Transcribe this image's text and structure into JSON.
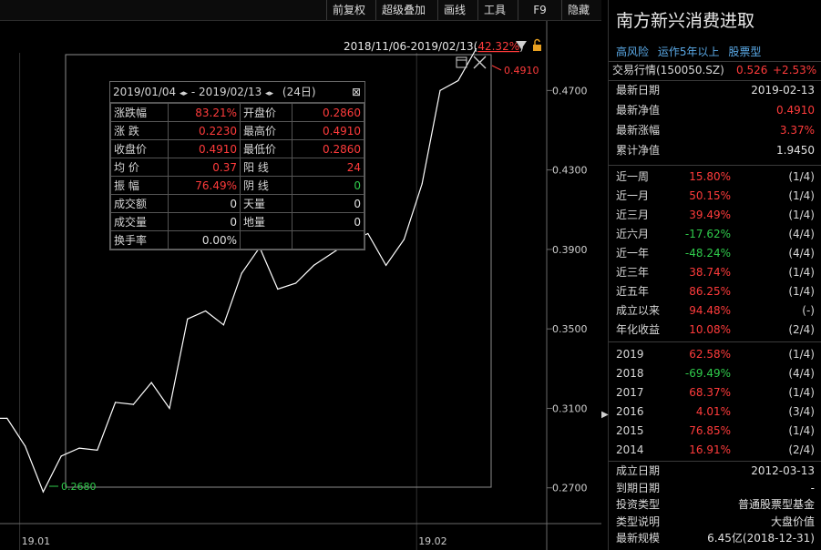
{
  "toolbar": {
    "items": [
      "前复权",
      "超级叠加",
      "画线",
      "工具",
      "F9",
      "隐藏"
    ]
  },
  "chart": {
    "range_label": "2018/11/06-2019/02/13(",
    "range_pct": "42.32%",
    "range_close": ")",
    "high_label": "0.4910",
    "low_label": "0.2680",
    "y_ticks": [
      "0.4700",
      "0.4300",
      "0.3900",
      "0.3500",
      "0.3100",
      "0.2700"
    ],
    "x_ticks": [
      "19.01",
      "19.02"
    ]
  },
  "chart_data": {
    "type": "line",
    "x": [
      "2018-12-27",
      "2018-12-28",
      "2019-01-02",
      "2019-01-03",
      "2019-01-04",
      "2019-01-07",
      "2019-01-08",
      "2019-01-09",
      "2019-01-10",
      "2019-01-11",
      "2019-01-14",
      "2019-01-15",
      "2019-01-16",
      "2019-01-17",
      "2019-01-18",
      "2019-01-21",
      "2019-01-22",
      "2019-01-23",
      "2019-01-24",
      "2019-01-25",
      "2019-01-28",
      "2019-01-29",
      "2019-01-30",
      "2019-01-31",
      "2019-02-01",
      "2019-02-11",
      "2019-02-12",
      "2019-02-13"
    ],
    "values": [
      0.305,
      0.305,
      0.291,
      0.268,
      0.286,
      0.29,
      0.289,
      0.313,
      0.312,
      0.323,
      0.31,
      0.355,
      0.359,
      0.352,
      0.378,
      0.391,
      0.37,
      0.373,
      0.382,
      0.388,
      0.394,
      0.398,
      0.382,
      0.395,
      0.423,
      0.47,
      0.475,
      0.491
    ],
    "ylim": [
      0.252,
      0.505
    ],
    "title": "",
    "xlabel": "",
    "ylabel": ""
  },
  "popup": {
    "date_from": "2019/01/04",
    "date_to": "2019/02/13",
    "days": "(24日)",
    "rows": [
      {
        "l1": "涨跌幅",
        "v1": "83.21%",
        "c1": "red",
        "l2": "开盘价",
        "v2": "0.2860",
        "c2": "red"
      },
      {
        "l1": "涨 跌",
        "v1": "0.2230",
        "c1": "red",
        "l2": "最高价",
        "v2": "0.4910",
        "c2": "red"
      },
      {
        "l1": "收盘价",
        "v1": "0.4910",
        "c1": "red",
        "l2": "最低价",
        "v2": "0.2860",
        "c2": "red"
      },
      {
        "l1": "均 价",
        "v1": "0.37",
        "c1": "red",
        "l2": "阳 线",
        "v2": "24",
        "c2": "red"
      },
      {
        "l1": "振 幅",
        "v1": "76.49%",
        "c1": "red",
        "l2": "阴 线",
        "v2": "0",
        "c2": "green"
      },
      {
        "l1": "成交额",
        "v1": "0",
        "c1": "white",
        "l2": "天量",
        "v2": "0",
        "c2": "white"
      },
      {
        "l1": "成交量",
        "v1": "0",
        "c1": "white",
        "l2": "地量",
        "v2": "0",
        "c2": "white"
      },
      {
        "l1": "换手率",
        "v1": "0.00%",
        "c1": "white",
        "l2": "",
        "v2": "",
        "c2": "white"
      }
    ]
  },
  "panel": {
    "title": "南方新兴消费进取",
    "tags": [
      "高风险",
      "运作5年以上",
      "股票型"
    ],
    "quote_label": "交易行情(150050.SZ)",
    "quote_price": "0.526",
    "quote_change": "+2.53%",
    "info": [
      {
        "k": "最新日期",
        "v": "2019-02-13",
        "c": "white"
      },
      {
        "k": "最新净值",
        "v": "0.4910",
        "c": "red"
      },
      {
        "k": "最新涨幅",
        "v": "3.37%",
        "c": "red"
      },
      {
        "k": "累计净值",
        "v": "1.9450",
        "c": "white"
      }
    ],
    "periods": [
      {
        "k": "近一周",
        "v": "15.80%",
        "c": "red",
        "r": "(1/4)"
      },
      {
        "k": "近一月",
        "v": "50.15%",
        "c": "red",
        "r": "(1/4)"
      },
      {
        "k": "近三月",
        "v": "39.49%",
        "c": "red",
        "r": "(1/4)"
      },
      {
        "k": "近六月",
        "v": "-17.62%",
        "c": "green",
        "r": "(4/4)"
      },
      {
        "k": "近一年",
        "v": "-48.24%",
        "c": "green",
        "r": "(4/4)"
      },
      {
        "k": "近三年",
        "v": "38.74%",
        "c": "red",
        "r": "(1/4)"
      },
      {
        "k": "近五年",
        "v": "86.25%",
        "c": "red",
        "r": "(1/4)"
      },
      {
        "k": "成立以来",
        "v": "94.48%",
        "c": "red",
        "r": "(-)"
      },
      {
        "k": "年化收益",
        "v": "10.08%",
        "c": "red",
        "r": "(2/4)"
      }
    ],
    "years": [
      {
        "k": "2019",
        "v": "62.58%",
        "c": "red",
        "r": "(1/4)"
      },
      {
        "k": "2018",
        "v": "-69.49%",
        "c": "green",
        "r": "(4/4)"
      },
      {
        "k": "2017",
        "v": "68.37%",
        "c": "red",
        "r": "(1/4)"
      },
      {
        "k": "2016",
        "v": "4.01%",
        "c": "red",
        "r": "(3/4)"
      },
      {
        "k": "2015",
        "v": "76.85%",
        "c": "red",
        "r": "(1/4)"
      },
      {
        "k": "2014",
        "v": "16.91%",
        "c": "red",
        "r": "(2/4)"
      }
    ],
    "meta": [
      {
        "k": "成立日期",
        "v": "2012-03-13"
      },
      {
        "k": "到期日期",
        "v": "-"
      },
      {
        "k": "投资类型",
        "v": "普通股票型基金"
      },
      {
        "k": "类型说明",
        "v": "大盘价值"
      },
      {
        "k": "最新规模",
        "v": "6.45亿(2018-12-31)"
      }
    ]
  }
}
